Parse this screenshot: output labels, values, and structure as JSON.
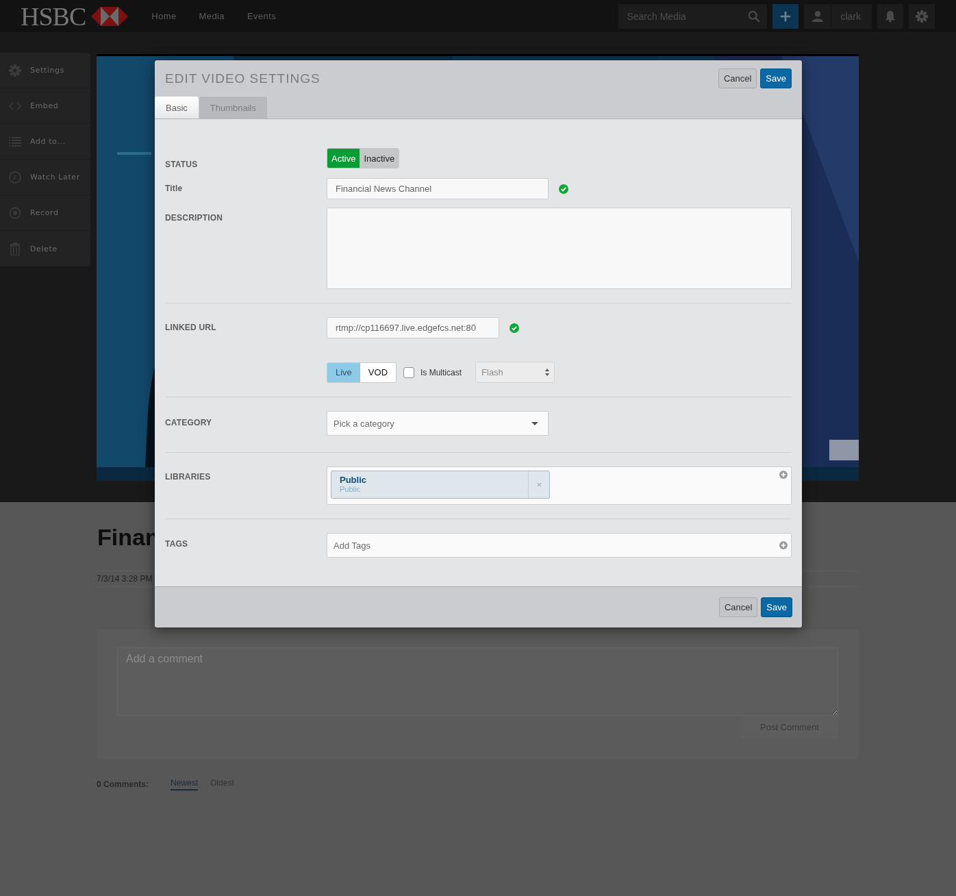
{
  "header": {
    "logo": "HSBC",
    "nav": [
      {
        "label": "Home"
      },
      {
        "label": "Media"
      },
      {
        "label": "Events"
      }
    ],
    "search": {
      "placeholder": "Search Media"
    },
    "user": "clark"
  },
  "sidebar": {
    "items": [
      {
        "label": "Settings",
        "kind": "gear"
      },
      {
        "label": "Embed",
        "kind": "code"
      },
      {
        "label": "Add to...",
        "kind": "list"
      },
      {
        "label": "Watch Later",
        "kind": "clock"
      },
      {
        "label": "Record",
        "kind": "record"
      },
      {
        "label": "Delete",
        "kind": "trash"
      }
    ]
  },
  "media": {
    "title": "Finan",
    "date": "7/3/14 3:28 PM"
  },
  "comments": {
    "placeholder": "Add a comment",
    "post_button": "Post Comment",
    "count": "0 Comments:",
    "sort": [
      {
        "label": "Newest",
        "selected": true
      },
      {
        "label": "Oldest",
        "selected": false
      }
    ]
  },
  "modal": {
    "title": "EDIT VIDEO SETTINGS",
    "buttons": [
      {
        "label": "Cancel",
        "kind": "secondary"
      },
      {
        "label": "Save",
        "kind": "primary"
      }
    ],
    "tabs": [
      {
        "label": "Basic",
        "selected": true
      },
      {
        "label": "Thumbnails",
        "selected": false
      }
    ],
    "status": {
      "label": "STATUS",
      "options": [
        {
          "label": "Active",
          "selected": true
        },
        {
          "label": "Inactive",
          "selected": false
        }
      ]
    },
    "title_field": {
      "label": "Title",
      "value": "Financial News Channel",
      "valid": true
    },
    "description": {
      "label": "DESCRIPTION"
    },
    "linked_url": {
      "label": "LINKED URL",
      "value": "rtmp://cp116697.live.edgefcs.net:80",
      "valid": true,
      "modes": [
        {
          "label": "Live",
          "selected": true
        },
        {
          "label": "VOD",
          "selected": false
        }
      ],
      "multicast": {
        "label": "Is Multicast",
        "checked": false
      },
      "player": {
        "value": "Flash"
      }
    },
    "category": {
      "label": "CATEGORY",
      "placeholder": "Pick a category"
    },
    "libraries": {
      "label": "LIBRARIES",
      "items": [
        {
          "name": "Public",
          "subtitle": "Public"
        }
      ]
    },
    "tags": {
      "label": "TAGS",
      "placeholder": "Add Tags"
    },
    "footer_buttons": [
      {
        "label": "Cancel",
        "kind": "secondary"
      },
      {
        "label": "Save",
        "kind": "primary"
      }
    ]
  }
}
